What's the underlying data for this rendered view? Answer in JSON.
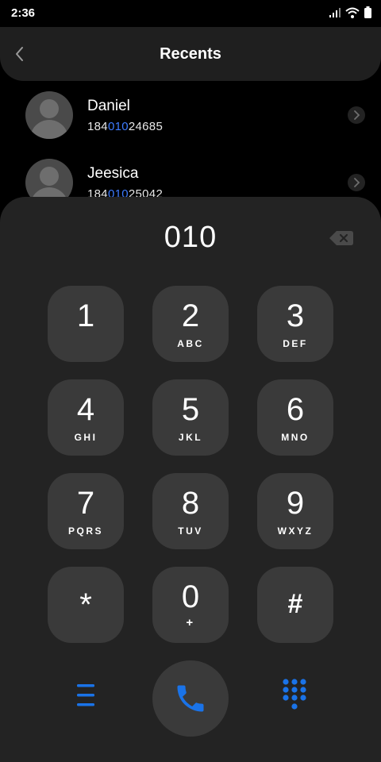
{
  "status": {
    "time": "2:36"
  },
  "header": {
    "title": "Recents"
  },
  "recents": [
    {
      "name": "Daniel",
      "number_prefix": "184",
      "number_match": "010",
      "number_suffix": "24685"
    },
    {
      "name": "Jeesica",
      "number_prefix": "184",
      "number_match": "010",
      "number_suffix": "25042"
    }
  ],
  "dialer": {
    "input": "010"
  },
  "keys": [
    {
      "digit": "1",
      "letters": ""
    },
    {
      "digit": "2",
      "letters": "ABC"
    },
    {
      "digit": "3",
      "letters": "DEF"
    },
    {
      "digit": "4",
      "letters": "GHI"
    },
    {
      "digit": "5",
      "letters": "JKL"
    },
    {
      "digit": "6",
      "letters": "MNO"
    },
    {
      "digit": "7",
      "letters": "PQRS"
    },
    {
      "digit": "8",
      "letters": "TUV"
    },
    {
      "digit": "9",
      "letters": "WXYZ"
    },
    {
      "digit": "*",
      "letters": ""
    },
    {
      "digit": "0",
      "letters": "+"
    },
    {
      "digit": "#",
      "letters": ""
    }
  ],
  "colors": {
    "accent": "#1a73e8",
    "highlight": "#3d7bff"
  }
}
